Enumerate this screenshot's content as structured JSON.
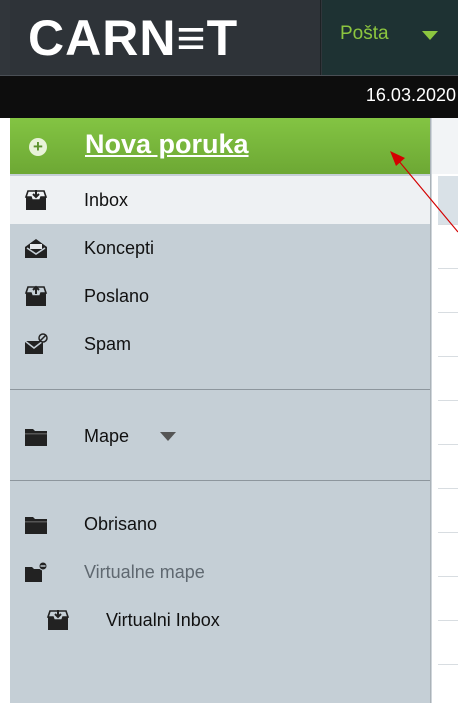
{
  "header": {
    "logo": "CARN≡T",
    "nav_menu": {
      "label": "Pošta"
    }
  },
  "datebar": {
    "date": "16.03.2020"
  },
  "sidebar": {
    "compose_label": "Nova poruka",
    "items": [
      {
        "label": "Inbox",
        "icon": "inbox-icon",
        "active": true
      },
      {
        "label": "Koncepti",
        "icon": "drafts-envelope-icon"
      },
      {
        "label": "Poslano",
        "icon": "sent-tray-icon"
      },
      {
        "label": "Spam",
        "icon": "spam-envelope-icon"
      }
    ],
    "folders_label": "Mape",
    "trash_label": "Obrisano",
    "virtual_folders_label": "Virtualne mape",
    "virtual_inbox_label": "Virtualni Inbox"
  },
  "colors": {
    "header_bg": "#31363b",
    "compose_green": "#6da834",
    "menu_accent": "#8cc63f",
    "sidebar_bg": "#c5cfd6",
    "annotation_arrow": "#d40000"
  }
}
